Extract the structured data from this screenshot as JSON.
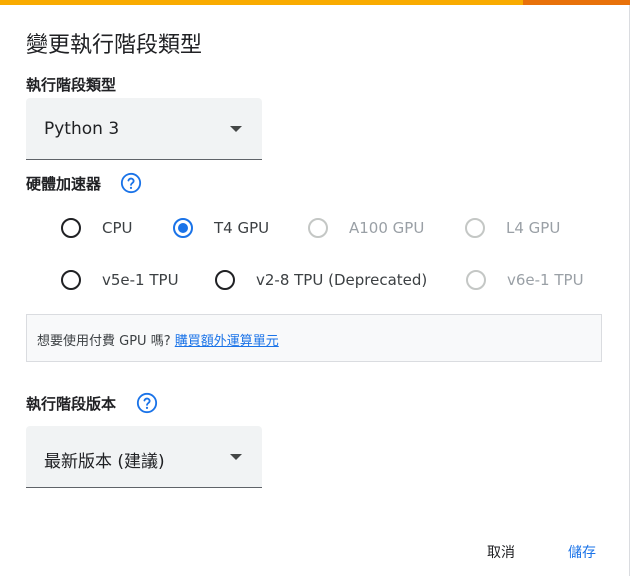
{
  "dialog": {
    "title": "變更執行階段類型",
    "runtime_type": {
      "label": "執行階段類型",
      "selected": "Python 3"
    },
    "hardware": {
      "label": "硬體加速器",
      "options": [
        {
          "label": "CPU",
          "state": "unchecked"
        },
        {
          "label": "T4 GPU",
          "state": "checked"
        },
        {
          "label": "A100 GPU",
          "state": "disabled"
        },
        {
          "label": "L4 GPU",
          "state": "disabled"
        },
        {
          "label": "v5e-1 TPU",
          "state": "unchecked"
        },
        {
          "label": "v2-8 TPU (Deprecated)",
          "state": "unchecked"
        },
        {
          "label": "v6e-1 TPU",
          "state": "disabled"
        }
      ]
    },
    "notice": {
      "text": "想要使用付費 GPU 嗎?",
      "link": "購買額外運算單元"
    },
    "runtime_version": {
      "label": "執行階段版本",
      "selected": "最新版本 (建議)"
    },
    "buttons": {
      "cancel": "取消",
      "save": "儲存"
    }
  },
  "colors": {
    "accent": "#1a73e8",
    "top_bar": "#f9ab00",
    "top_bar_end": "#e8710a"
  },
  "icons": {
    "help": "help-circle-icon",
    "dropdown": "caret-down-icon"
  }
}
